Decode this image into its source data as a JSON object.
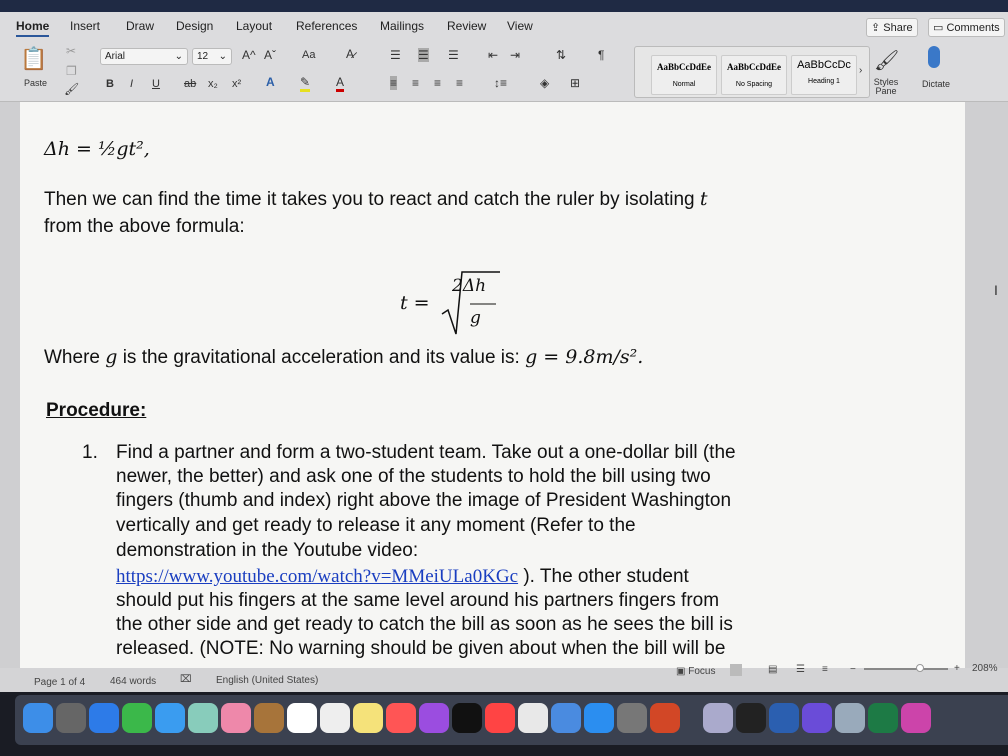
{
  "ribbon_tabs": [
    "Home",
    "Insert",
    "Draw",
    "Design",
    "Layout",
    "References",
    "Mailings",
    "Review",
    "View"
  ],
  "share": "Share",
  "comments": "Comments",
  "clipboard": {
    "paste": "Paste"
  },
  "font": {
    "name": "Arial",
    "size": "12",
    "case": "Aa",
    "bold": "B",
    "italic": "I",
    "underline": "U",
    "strike": "ab",
    "sub": "x₂",
    "sup": "x²",
    "grow": "A^",
    "shrink": "Aˇ"
  },
  "styles": [
    {
      "preview": "AaBbCcDdEe",
      "name": "Normal"
    },
    {
      "preview": "AaBbCcDdEe",
      "name": "No Spacing"
    },
    {
      "preview": "AaBbCcDc",
      "name": "Heading 1"
    }
  ],
  "styles_pane": "Styles Pane",
  "dictate": "Dictate",
  "doc": {
    "eq1": "Δh = ½gt²,",
    "p1a": "Then we can find the time it takes you to react and catch the ruler by isolating ",
    "p1var": "t",
    "p1b": "from the above formula:",
    "eq2_lhs": "t =",
    "eq2_num": "2Δh",
    "eq2_den": "g",
    "p2a": "Where ",
    "p2g": "g",
    "p2b": " is the gravitational acceleration and its value is: ",
    "p2eq": "g = 9.8m/s².",
    "heading": "Procedure:",
    "item_num": "1.",
    "item_lines": [
      "Find a partner and form a two-student team. Take out a one-dollar bill (the",
      "newer, the better) and ask one of the students to hold the bill using two",
      "fingers (thumb and index) right above the image of President Washington",
      "vertically and get ready to release it any moment (Refer to the",
      "demonstration in the Youtube video:"
    ],
    "link": "https://www.youtube.com/watch?v=MMeiULa0KGc",
    "after_link": " ). The other student",
    "item_lines2": [
      "should put his fingers at the same level around his partners fingers from",
      "the other side and get ready to catch the bill as soon as he sees the bill is",
      "released. (NOTE: No warning should be given about when the bill will be"
    ]
  },
  "status": {
    "page": "Page 1 of 4",
    "words": "464 words",
    "language": "English (United States)",
    "focus": "Focus",
    "zoom": "208%"
  },
  "dock_apps": [
    "finder",
    "launchpad",
    "safari",
    "facetime",
    "messages",
    "maps",
    "photos",
    "notebook",
    "calendar",
    "reminders",
    "notes",
    "music",
    "podcasts",
    "tv",
    "news",
    "numbers",
    "keynote",
    "app-store",
    "system-preferences",
    "powerpoint",
    "preview",
    "activity-monitor",
    "word",
    "imovie",
    "mail",
    "excel",
    "siri"
  ]
}
